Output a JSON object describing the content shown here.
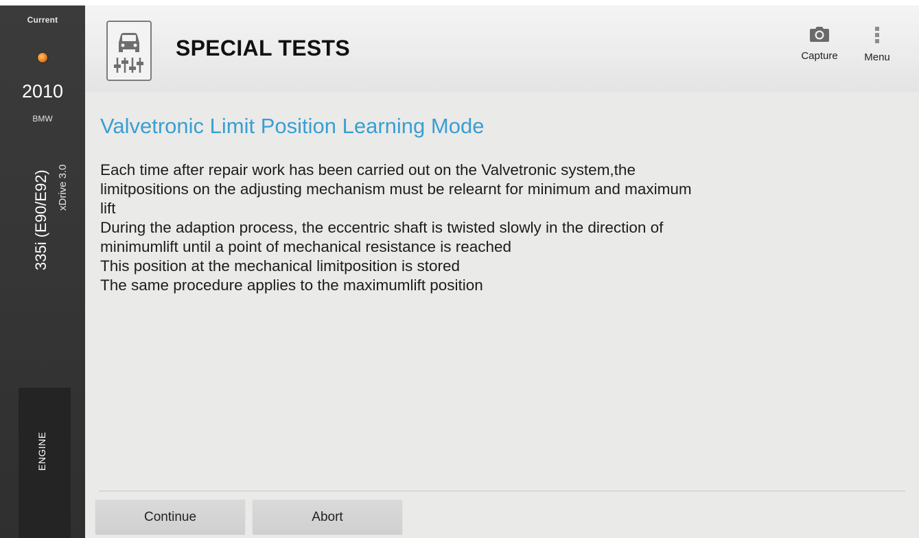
{
  "vehicle": {
    "status_label": "Current",
    "status_color": "#f08a24",
    "year": "2010",
    "make": "BMW",
    "model": "335i (E90/E92)",
    "trim": "xDrive 3.0",
    "system": "ENGINE"
  },
  "header": {
    "app_icon": "car-diagnostics-icon",
    "title": "SPECIAL TESTS",
    "actions": [
      {
        "label": "Capture",
        "icon": "camera-icon"
      },
      {
        "label": "Menu",
        "icon": "overflow-menu-icon"
      }
    ]
  },
  "test": {
    "title": "Valvetronic Limit Position Learning Mode",
    "title_color": "#3a9fd0",
    "description_lines": [
      "Each time after repair work has been carried out on the Valvetronic system,the",
      "limitpositions on the adjusting mechanism must be relearnt for minimum and maximum",
      "lift",
      "During the adaption process, the eccentric shaft is twisted slowly in the direction of",
      "minimumlift until a point of mechanical resistance is reached",
      "This position at the mechanical limitposition is stored",
      "The same procedure applies to the maximumlift position"
    ]
  },
  "footer": {
    "continue_label": "Continue",
    "abort_label": "Abort"
  }
}
